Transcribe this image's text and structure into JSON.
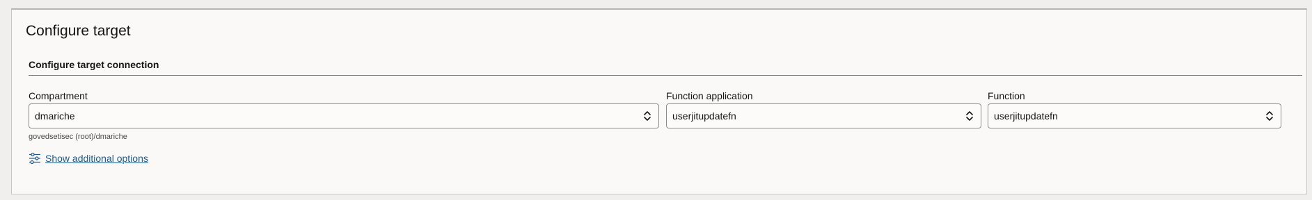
{
  "panel": {
    "title": "Configure target",
    "section_title": "Configure target connection"
  },
  "fields": {
    "compartment": {
      "label": "Compartment",
      "value": "dmariche",
      "helper": "govedsetisec (root)/dmariche"
    },
    "function_application": {
      "label": "Function application",
      "value": "userjitupdatefn"
    },
    "function": {
      "label": "Function",
      "value": "userjitupdatefn"
    }
  },
  "options_link": {
    "label": "Show additional options",
    "icon": "sliders-icon"
  },
  "colors": {
    "link": "#1b5a8a",
    "panel_bg": "#fbf9f8",
    "page_bg": "#f1efed"
  }
}
